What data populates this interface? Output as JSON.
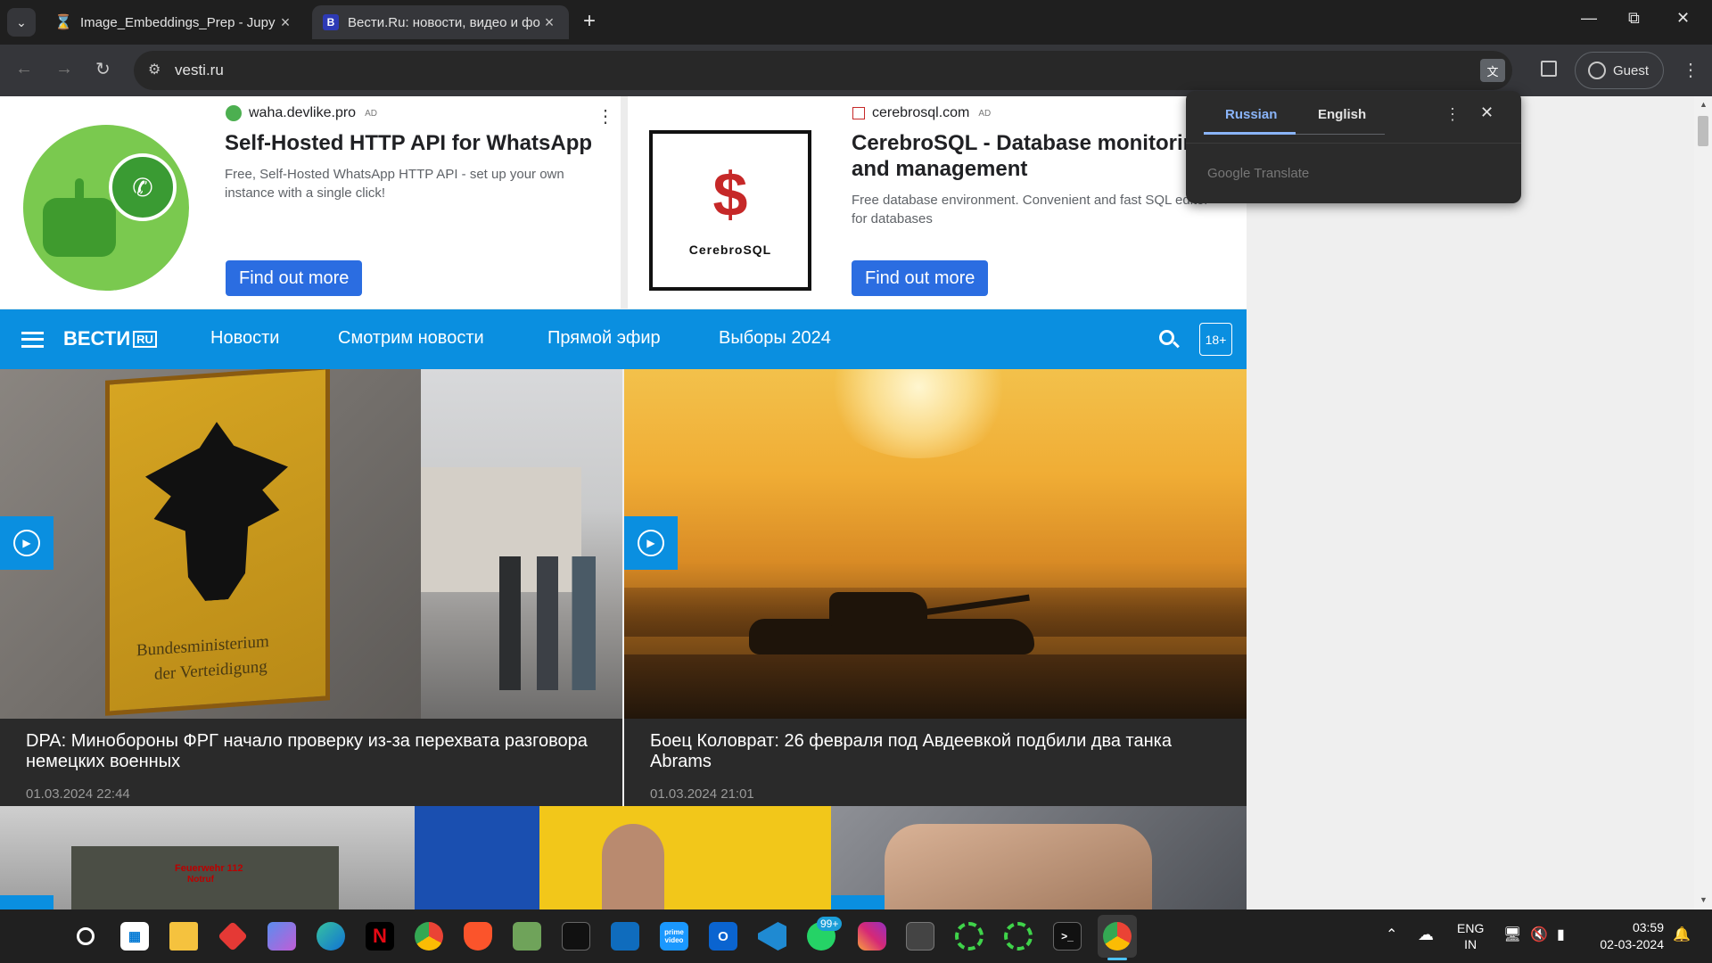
{
  "browser": {
    "tabs": [
      {
        "title": "Image_Embeddings_Prep - Jupy",
        "favicon": "hourglass-icon",
        "active": false
      },
      {
        "title": "Вести.Ru: новости, видео и фо",
        "favicon": "vesti-b-icon",
        "active": true
      }
    ],
    "new_tab_glyph": "+",
    "url": "vesti.ru",
    "profile_label": "Guest"
  },
  "ads": [
    {
      "domain": "waha.devlike.pro",
      "ad_tag": "AD",
      "title": "Self-Hosted HTTP API for WhatsApp",
      "description": "Free, Self-Hosted WhatsApp HTTP API - set up your own instance with a single click!",
      "button": "Find out more"
    },
    {
      "domain": "cerebrosql.com",
      "ad_tag": "AD",
      "title": "CerebroSQL - Database monitoring and management",
      "description": "Free database environment. Convenient and fast SQL editor for databases",
      "logo_text": "CerebroSQL",
      "button": "Find out more"
    }
  ],
  "site_nav": {
    "logo": "ВЕСТИ",
    "logo_suffix": "RU",
    "items": [
      "Новости",
      "Смотрим новости",
      "Прямой эфир",
      "Выборы 2024"
    ],
    "age_badge": "18+"
  },
  "news": [
    {
      "headline": "DPA: Минобороны ФРГ начало проверку из-за перехвата разговора немецких военных",
      "date": "01.03.2024 22:44",
      "sign_text_1": "Bundesministerium",
      "sign_text_2": "der Verteidigung"
    },
    {
      "headline": "Боец Коловрат: 26 февраля под Авдеевкой подбили два танка Abrams",
      "date": "01.03.2024 21:01"
    }
  ],
  "bottom_thumbs": [
    {
      "caption_1": "Feuerwehr 112",
      "caption_2": "Notruf"
    }
  ],
  "translate_popup": {
    "languages": [
      "Russian",
      "English"
    ],
    "active_language": "Russian",
    "brand": "Google Translate"
  },
  "taskbar": {
    "apps": [
      "start",
      "search",
      "store",
      "file-explorer",
      "photos-app",
      "copilot",
      "edge",
      "netflix",
      "chrome",
      "brave",
      "notepad",
      "terminal",
      "outlook-pane",
      "prime-video",
      "outlook",
      "vscode",
      "whatsapp",
      "instagram",
      "app-window",
      "spinner-app-1",
      "spinner-app-2",
      "cmd",
      "chrome-active"
    ],
    "whatsapp_badge": "99+",
    "prime_label": "prime video",
    "language_line1": "ENG",
    "language_line2": "IN",
    "time": "03:59",
    "date": "02-03-2024"
  },
  "colors": {
    "vesti_blue": "#0a8fe0",
    "ad_button": "#2b6de1",
    "translate_active": "#8ab4f8",
    "browser_dark": "#1f1f1f"
  }
}
